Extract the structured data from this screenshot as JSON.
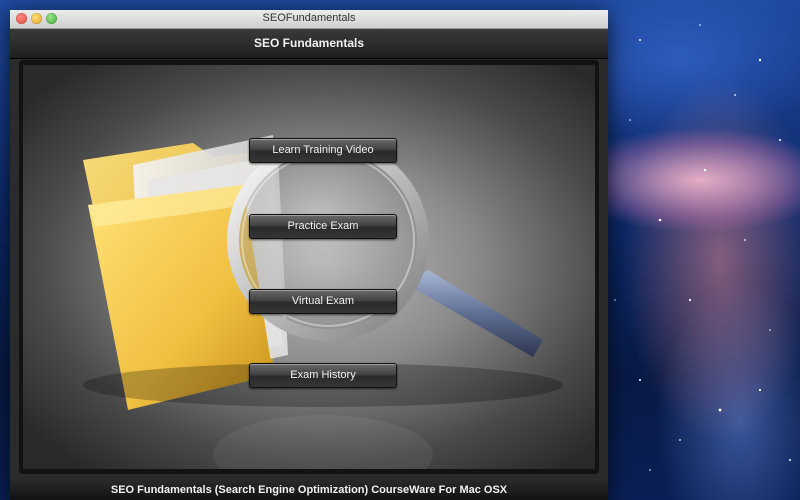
{
  "window": {
    "title": "SEOFundamentals"
  },
  "header": {
    "title": "SEO Fundamentals"
  },
  "menu": {
    "buttons": [
      {
        "label": "Learn Training Video"
      },
      {
        "label": "Practice Exam"
      },
      {
        "label": "Virtual Exam"
      },
      {
        "label": "Exam History"
      }
    ]
  },
  "footer": {
    "text": "SEO Fundamentals (Search Engine Optimization) CourseWare For Mac OSX"
  },
  "icons": {
    "hero": "folder-magnifier-icon"
  }
}
